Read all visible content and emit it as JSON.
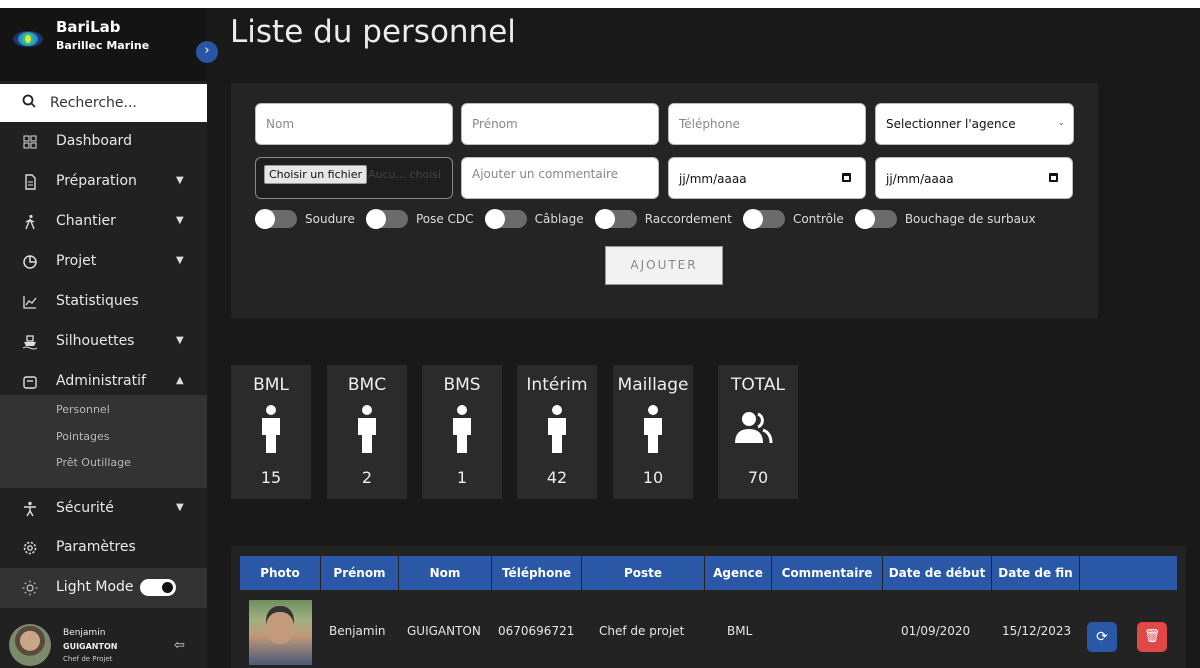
{
  "app": {
    "name": "BariLab",
    "company": "Barillec Marine"
  },
  "search": {
    "placeholder": "Recherche..."
  },
  "sidebar": {
    "items": [
      {
        "label": "Dashboard",
        "icon": "grid-icon"
      },
      {
        "label": "Préparation",
        "icon": "document-icon"
      },
      {
        "label": "Chantier",
        "icon": "walking-person-icon"
      },
      {
        "label": "Projet",
        "icon": "pie-chart-icon"
      },
      {
        "label": "Statistiques",
        "icon": "line-chart-icon"
      },
      {
        "label": "Silhouettes",
        "icon": "ship-icon"
      },
      {
        "label": "Administratif",
        "icon": "inbox-icon"
      },
      {
        "label": "Sécurité",
        "icon": "person-icon"
      },
      {
        "label": "Paramètres",
        "icon": "gear-icon"
      }
    ],
    "subitems": [
      "Personnel",
      "Pointages",
      "Prêt Outillage"
    ],
    "light_mode": "Light Mode"
  },
  "user": {
    "first": "Benjamin",
    "last": "GUIGANTON",
    "role": "Chef de Projet"
  },
  "page": {
    "title": "Liste du personnel"
  },
  "form": {
    "nom_placeholder": "Nom",
    "prenom_placeholder": "Prénom",
    "telephone_placeholder": "Téléphone",
    "agence_select": "Selectionner l'agence",
    "file_button": "Choisir un fichier",
    "file_none": "Aucu... choisi",
    "comment_placeholder": "Ajouter un commentaire",
    "date_placeholder": "jj/mm/aaaa",
    "toggles": [
      "Soudure",
      "Pose CDC",
      "Câblage",
      "Raccordement",
      "Contrôle",
      "Bouchage de surbaux"
    ],
    "add_button": "AJOUTER"
  },
  "stats": [
    {
      "label": "BML",
      "value": "15"
    },
    {
      "label": "BMC",
      "value": "2"
    },
    {
      "label": "BMS",
      "value": "1"
    },
    {
      "label": "Intérim",
      "value": "42"
    },
    {
      "label": "Maillage",
      "value": "10"
    },
    {
      "label": "TOTAL",
      "value": "70"
    }
  ],
  "table": {
    "headers": [
      "Photo",
      "Prénom",
      "Nom",
      "Téléphone",
      "Poste",
      "Agence",
      "Commentaire",
      "Date de début",
      "Date de fin",
      ""
    ],
    "rows": [
      {
        "prenom": "Benjamin",
        "nom": "GUIGANTON",
        "telephone": "0670696721",
        "poste": "Chef de projet",
        "agence": "BML",
        "commentaire": "",
        "debut": "01/09/2020",
        "fin": "15/12/2023"
      }
    ]
  },
  "colors": {
    "accent": "#2a57a6",
    "danger": "#e04848",
    "background": "#191919"
  }
}
